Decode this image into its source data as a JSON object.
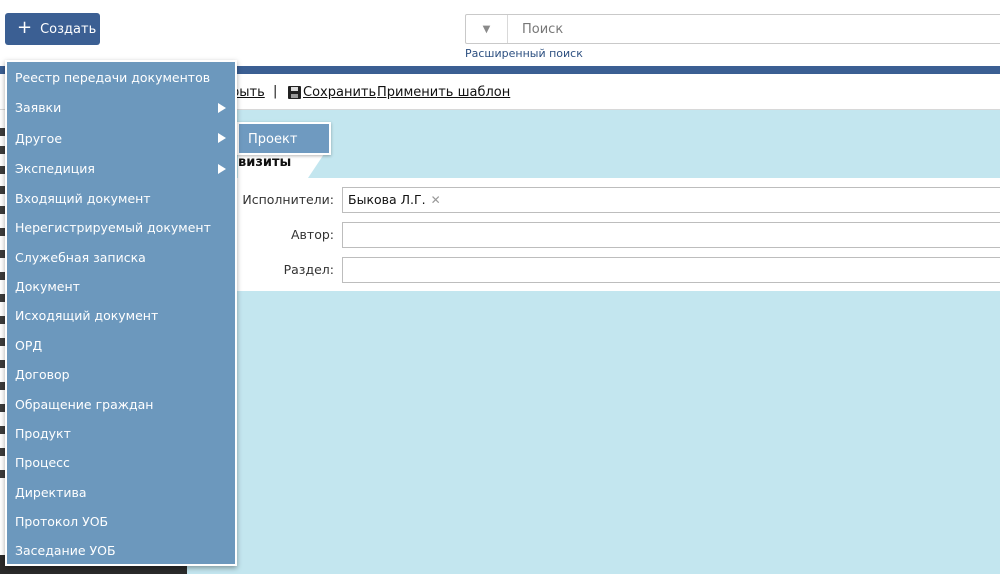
{
  "header": {
    "create_label": "Создать",
    "create_icon": "plus-icon",
    "search_placeholder": "Поиск",
    "advanced_search": "Расширенный поиск"
  },
  "toolbar": {
    "close_label": "рыть",
    "separator": "|",
    "save_label": "Сохранить",
    "apply_template_label": "Применить шаблон"
  },
  "tab": {
    "label": "визиты"
  },
  "form": {
    "executors_label": "Исполнители:",
    "executor_value": "Быкова Л.Г.",
    "author_label": "Автор:",
    "author_value": "",
    "section_label": "Раздел:",
    "section_value": ""
  },
  "create_menu": {
    "items": [
      {
        "label": "Реестр передачи документов",
        "submenu": false
      },
      {
        "label": "Заявки",
        "submenu": true
      },
      {
        "label": "Другое",
        "submenu": true
      },
      {
        "label": "Экспедиция",
        "submenu": true
      },
      {
        "label": "Входящий документ",
        "submenu": false
      },
      {
        "label": "Нерегистрируемый документ",
        "submenu": false
      },
      {
        "label": "Служебная записка",
        "submenu": false
      },
      {
        "label": "Документ",
        "submenu": false
      },
      {
        "label": "Исходящий документ",
        "submenu": false
      },
      {
        "label": "ОРД",
        "submenu": false
      },
      {
        "label": "Договор",
        "submenu": false
      },
      {
        "label": "Обращение граждан",
        "submenu": false
      },
      {
        "label": "Продукт",
        "submenu": false
      },
      {
        "label": "Процесс",
        "submenu": false
      },
      {
        "label": "Директива",
        "submenu": false
      },
      {
        "label": "Протокол УОБ",
        "submenu": false
      },
      {
        "label": "Заседание УОБ",
        "submenu": false
      }
    ]
  },
  "submenu": {
    "items": [
      "Проект"
    ]
  },
  "colors": {
    "brand": "#3b5f93",
    "menu_bg": "#6c98bd",
    "content_bg": "#c3e6ef"
  }
}
